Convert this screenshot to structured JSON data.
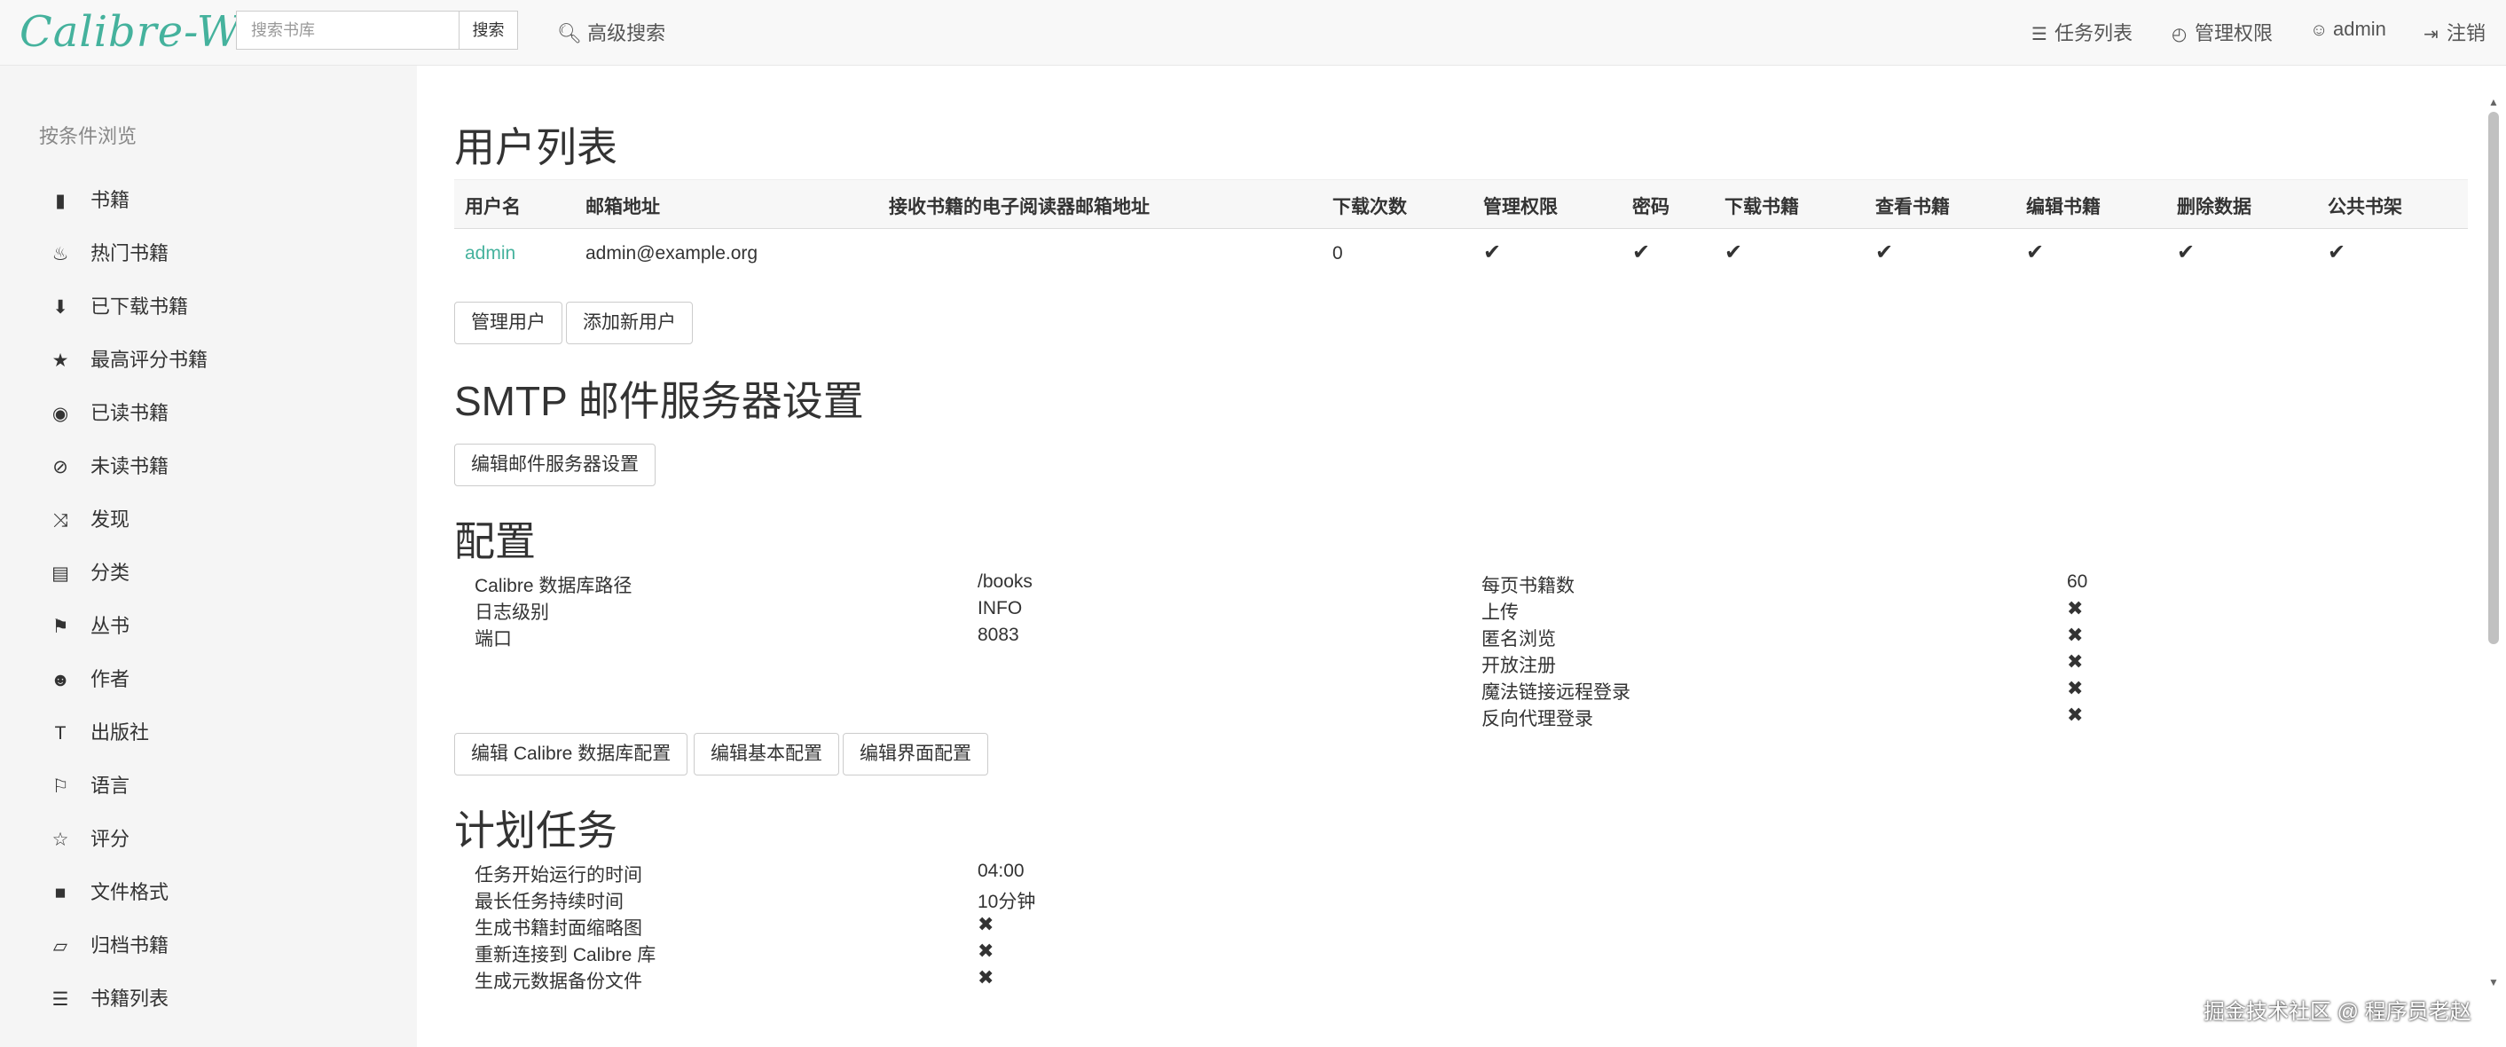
{
  "navbar": {
    "logo": "Calibre-Web",
    "search_placeholder": "搜索书库",
    "search_button": "搜索",
    "advanced_search": "高级搜索",
    "tasks": "任务列表",
    "admin_settings": "管理权限",
    "user": "admin",
    "logout": "注销"
  },
  "sidebar": {
    "title": "按条件浏览",
    "items": [
      {
        "label": "书籍",
        "icon": "book-icon"
      },
      {
        "label": "热门书籍",
        "icon": "fire-icon"
      },
      {
        "label": "已下载书籍",
        "icon": "download-icon"
      },
      {
        "label": "最高评分书籍",
        "icon": "star-icon"
      },
      {
        "label": "已读书籍",
        "icon": "eye-icon"
      },
      {
        "label": "未读书籍",
        "icon": "eye-slash-icon"
      },
      {
        "label": "发现",
        "icon": "random-icon"
      },
      {
        "label": "分类",
        "icon": "inbox-icon"
      },
      {
        "label": "丛书",
        "icon": "bookmark-icon"
      },
      {
        "label": "作者",
        "icon": "user-icon"
      },
      {
        "label": "出版社",
        "icon": "text-size-icon"
      },
      {
        "label": "语言",
        "icon": "flag-icon"
      },
      {
        "label": "评分",
        "icon": "star-empty-icon"
      },
      {
        "label": "文件格式",
        "icon": "file-icon"
      },
      {
        "label": "归档书籍",
        "icon": "folder-open-icon"
      },
      {
        "label": "书籍列表",
        "icon": "list-icon"
      }
    ]
  },
  "users": {
    "title": "用户列表",
    "columns": [
      "用户名",
      "邮箱地址",
      "接收书籍的电子阅读器邮箱地址",
      "下载次数",
      "管理权限",
      "密码",
      "下载书籍",
      "查看书籍",
      "编辑书籍",
      "删除数据",
      "公共书架"
    ],
    "rows": [
      {
        "username": "admin",
        "email": "admin@example.org",
        "ereader_email": "",
        "downloads": "0",
        "admin": true,
        "password": true,
        "download": true,
        "view": true,
        "edit": true,
        "delete": true,
        "public_shelf": true
      }
    ],
    "btn_manage": "管理用户",
    "btn_add": "添加新用户"
  },
  "smtp": {
    "title": "SMTP 邮件服务器设置",
    "btn_edit": "编辑邮件服务器设置"
  },
  "config": {
    "title": "配置",
    "left": [
      {
        "label": "Calibre 数据库路径",
        "value": "/books"
      },
      {
        "label": "日志级别",
        "value": "INFO"
      },
      {
        "label": "端口",
        "value": "8083"
      }
    ],
    "right": [
      {
        "label": "每页书籍数",
        "value": "60"
      },
      {
        "label": "上传",
        "value": "✖"
      },
      {
        "label": "匿名浏览",
        "value": "✖"
      },
      {
        "label": "开放注册",
        "value": "✖"
      },
      {
        "label": "魔法链接远程登录",
        "value": "✖"
      },
      {
        "label": "反向代理登录",
        "value": "✖"
      }
    ],
    "btn_db": "编辑 Calibre 数据库配置",
    "btn_basic": "编辑基本配置",
    "btn_ui": "编辑界面配置"
  },
  "scheduled": {
    "title": "计划任务",
    "items": [
      {
        "label": "任务开始运行的时间",
        "value": "04:00"
      },
      {
        "label": "最长任务持续时间",
        "value": "10分钟"
      },
      {
        "label": "生成书籍封面缩略图",
        "value": "✖"
      },
      {
        "label": "重新连接到 Calibre 库",
        "value": "✖"
      },
      {
        "label": "生成元数据备份文件",
        "value": "✖"
      }
    ]
  },
  "footer_note": "掘金技术社区 @ 程序员老赵",
  "accent_color": "#45b29d"
}
